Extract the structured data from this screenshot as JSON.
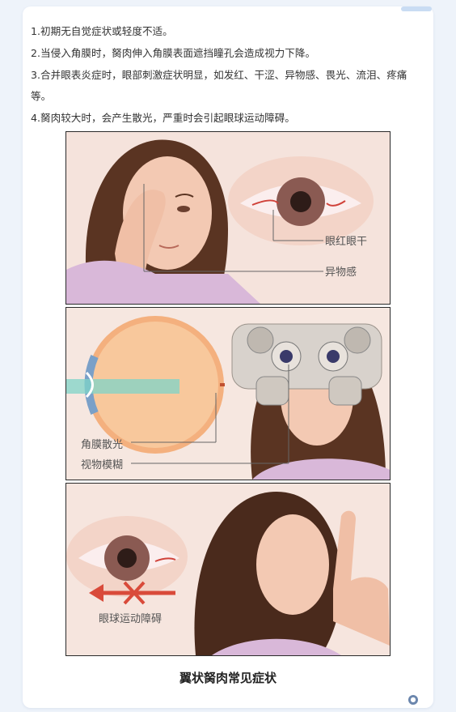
{
  "symptoms": [
    "1.初期无自觉症状或轻度不适。",
    "2.当侵入角膜时，胬肉伸入角膜表面遮挡瞳孔会造成视力下降。",
    "3.合并眼表炎症时，眼部刺激症状明显，如发红、干涩、异物感、畏光、流泪、疼痛等。",
    "4.胬肉较大时，会产生散光，严重时会引起眼球运动障碍。"
  ],
  "figure": {
    "panel1": {
      "label_red_dry": "眼红眼干",
      "label_foreign_body": "异物感"
    },
    "panel2": {
      "label_astigmatism": "角膜散光",
      "label_blur": "视物模糊"
    },
    "panel3": {
      "label_movement": "眼球运动障碍"
    },
    "caption": "翼状胬肉常见症状"
  },
  "colors": {
    "card_bg": "#ffffff",
    "page_bg": "#eef3fa",
    "text": "#333333"
  }
}
